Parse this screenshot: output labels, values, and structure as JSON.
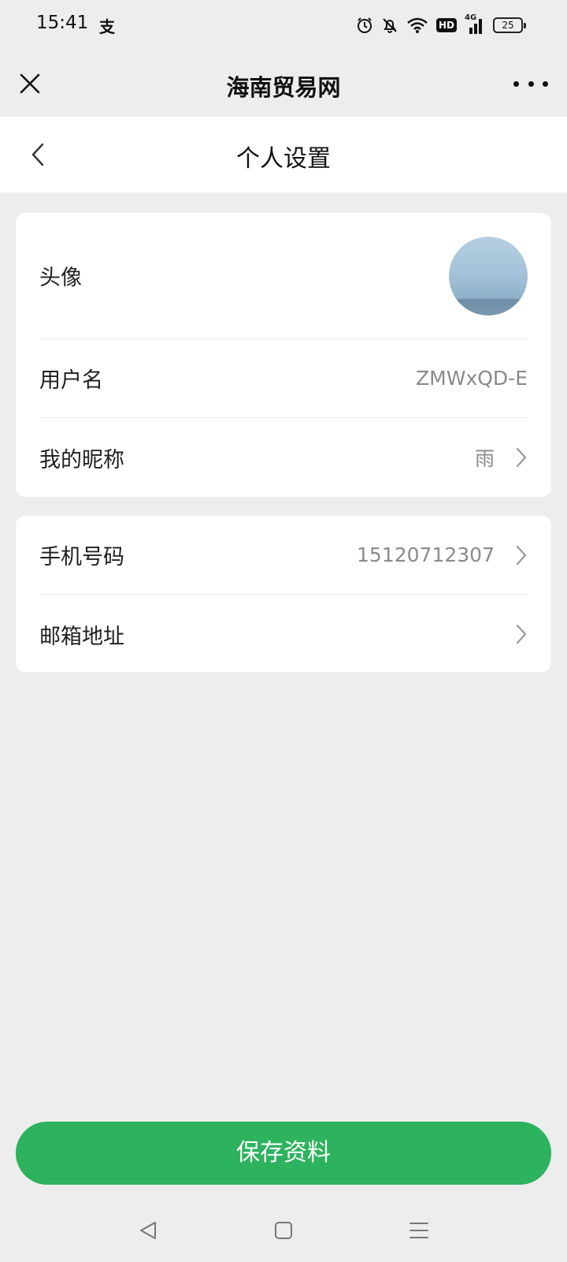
{
  "status_bar": {
    "time": "15:41",
    "app_icon": "支",
    "icons": [
      "alarm-icon",
      "mute-bell-icon",
      "wifi-icon",
      "hd-icon",
      "signal-4g-icon",
      "battery-icon"
    ],
    "hd_label": "HD",
    "network_label": "4G",
    "battery_level": "25"
  },
  "top_bar": {
    "title": "海南贸易网",
    "close_icon": "close-icon",
    "more_icon": "more-icon"
  },
  "page_header": {
    "title": "个人设置",
    "back_icon": "chevron-left-icon"
  },
  "profile": {
    "avatar_label": "头像",
    "username_label": "用户名",
    "username_value": "ZMWxQD-E",
    "nickname_label": "我的昵称",
    "nickname_value": "雨"
  },
  "contact": {
    "phone_label": "手机号码",
    "phone_value": "15120712307",
    "email_label": "邮箱地址",
    "email_value": ""
  },
  "save_button": {
    "label": "保存资料",
    "color": "#2db25d"
  },
  "nav_bar": {
    "icons": [
      "triangle-back-icon",
      "square-home-icon",
      "menu-lines-icon"
    ]
  },
  "colors": {
    "background": "#ededed",
    "card": "#ffffff",
    "secondary_text": "#8a8a8a"
  }
}
